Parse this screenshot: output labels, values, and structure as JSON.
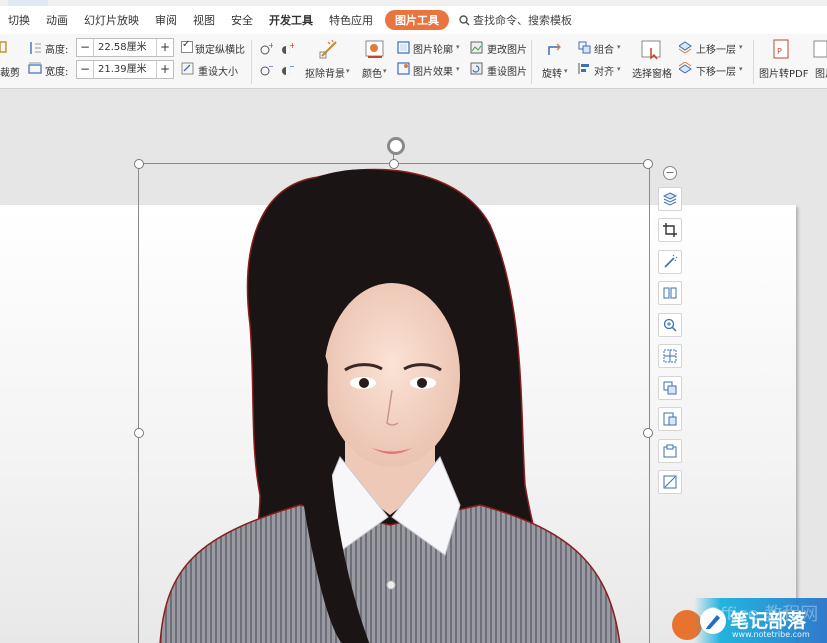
{
  "menu": {
    "items": [
      "切换",
      "动画",
      "幻灯片放映",
      "审阅",
      "视图",
      "安全",
      "开发工具",
      "特色应用"
    ],
    "active_tab": "图片工具",
    "search_label": "查找命令、搜索模板"
  },
  "ribbon": {
    "crop_label": "裁剪",
    "height_label": "高度:",
    "height_value": "22.58厘米",
    "width_label": "宽度:",
    "width_value": "21.39厘米",
    "lock_ratio_label": "锁定纵横比",
    "reset_size_label": "重设大小",
    "remove_bg_label": "抠除背景",
    "color_label": "颜色",
    "outline_label": "图片轮廓",
    "effects_label": "图片效果",
    "change_pic_label": "更改图片",
    "reset_pic_label": "重设图片",
    "rotate_label": "旋转",
    "group_label": "组合",
    "align_label": "对齐",
    "selection_pane_label": "选择窗格",
    "bring_forward_label": "上移一层",
    "send_backward_label": "下移一层",
    "to_pdf_label": "图片转PDF",
    "last_label": "图片"
  },
  "watermark": {
    "title": "笔记部落",
    "subtitle": "www.notetribe.com",
    "faint": "Office 教程网"
  },
  "colors": {
    "accent": "#e9743d",
    "ribbon_bg": "#f7f7f7",
    "canvas_bg": "#e6e6e6"
  }
}
